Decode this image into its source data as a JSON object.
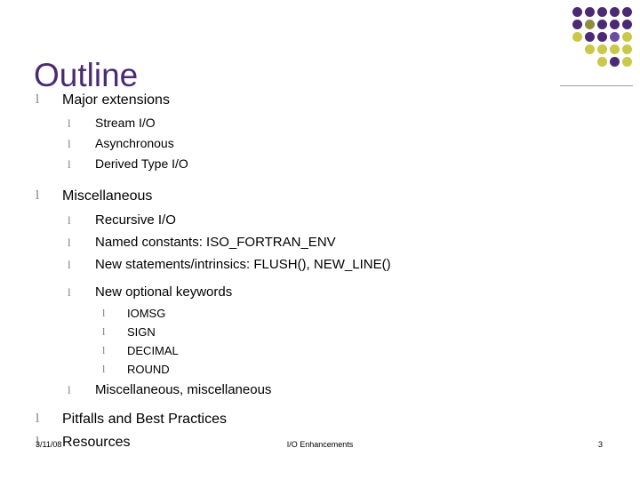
{
  "slide": {
    "title": "Outline",
    "accent_color": "#4b2a74",
    "bullet_glyph": "l",
    "decoration": {
      "name": "dot-grid",
      "colors": [
        "#4b2a74",
        "#8e8e3f",
        "#c8c84a",
        "#b9b945",
        "#6b4f9e"
      ]
    }
  },
  "outline": {
    "items": [
      {
        "label": "Major extensions",
        "children": [
          {
            "label": "Stream I/O"
          },
          {
            "label": "Asynchronous"
          },
          {
            "label": "Derived Type I/O"
          }
        ]
      },
      {
        "label": "Miscellaneous",
        "children": [
          {
            "label": "Recursive I/O"
          },
          {
            "label": "Named constants: ISO_FORTRAN_ENV"
          },
          {
            "label": "New statements/intrinsics: FLUSH(), NEW_LINE()"
          },
          {
            "label": "New optional keywords",
            "children": [
              {
                "label": "IOMSG"
              },
              {
                "label": "SIGN"
              },
              {
                "label": "DECIMAL"
              },
              {
                "label": "ROUND"
              }
            ]
          },
          {
            "label": "Miscellaneous, miscellaneous"
          }
        ]
      },
      {
        "label": "Pitfalls and Best Practices"
      },
      {
        "label": "Resources"
      }
    ]
  },
  "footer": {
    "date": "3/11/08",
    "center": "I/O Enhancements",
    "page": "3"
  }
}
